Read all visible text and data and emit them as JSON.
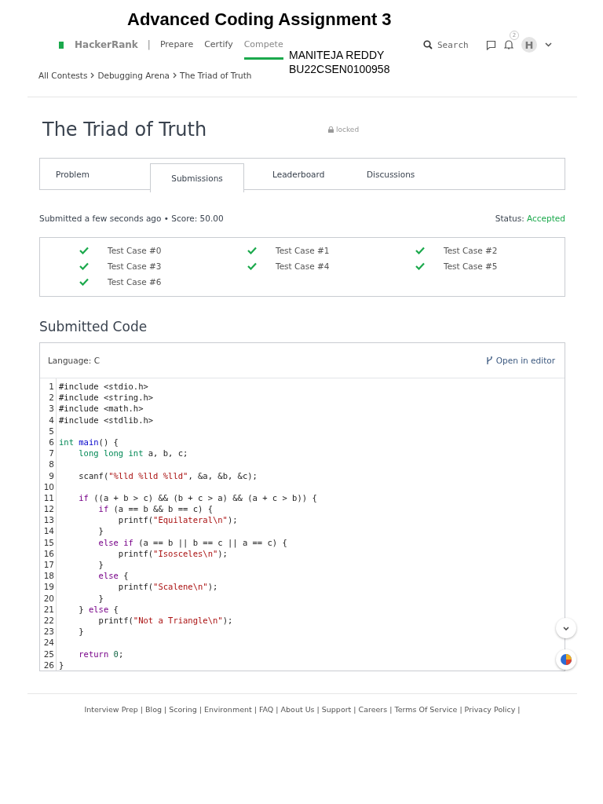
{
  "doc_title": "Advanced Coding Assignment 3",
  "nav": {
    "brand": "HackerRank",
    "divider": "|",
    "items": [
      {
        "label": "Prepare",
        "selected": false
      },
      {
        "label": "Certify",
        "selected": false
      },
      {
        "label": "Compete",
        "selected": true
      }
    ],
    "search_placeholder": "Search",
    "notifications": "2",
    "avatar": "H"
  },
  "student": [
    "MANITEJA REDDY",
    "BU22CSEN0100958"
  ],
  "breadcrumb": [
    "All Contests",
    "Debugging Arena",
    "The Triad of Truth"
  ],
  "challenge": {
    "title": "The Triad of Truth",
    "lock_label": "locked"
  },
  "tabs": [
    {
      "label": "Problem",
      "selected": false
    },
    {
      "label": "Submissions",
      "selected": true
    },
    {
      "label": "Leaderboard",
      "selected": false
    },
    {
      "label": "Discussions",
      "selected": false
    }
  ],
  "submission": {
    "summary": "Submitted a few seconds ago • Score: 50.00",
    "status_label": "Status:",
    "status": "Accepted"
  },
  "test_cases": [
    {
      "label": "Test Case #0",
      "passed": true
    },
    {
      "label": "Test Case #1",
      "passed": true
    },
    {
      "label": "Test Case #2",
      "passed": true
    },
    {
      "label": "Test Case #3",
      "passed": true
    },
    {
      "label": "Test Case #4",
      "passed": true
    },
    {
      "label": "Test Case #5",
      "passed": true
    },
    {
      "label": "Test Case #6",
      "passed": true
    }
  ],
  "code_section": {
    "heading": "Submitted Code",
    "language": "Language: C",
    "open_editor": "Open in editor",
    "lines": [
      {
        "number": "1",
        "tokens": [
          {
            "kind": "plain",
            "text": "#include <stdio.h>"
          }
        ]
      },
      {
        "number": "2",
        "tokens": [
          {
            "kind": "plain",
            "text": "#include <string.h>"
          }
        ]
      },
      {
        "number": "3",
        "tokens": [
          {
            "kind": "plain",
            "text": "#include <math.h>"
          }
        ]
      },
      {
        "number": "4",
        "tokens": [
          {
            "kind": "plain",
            "text": "#include <stdlib.h>"
          }
        ]
      },
      {
        "number": "5"
      },
      {
        "number": "6",
        "tokens": [
          {
            "kind": "type",
            "text": "int"
          },
          {
            "kind": "fn",
            "text": " main"
          },
          {
            "kind": "plain",
            "text": "() {"
          }
        ]
      },
      {
        "number": "7",
        "tokens": [
          {
            "kind": "type",
            "text": "    long long int"
          },
          {
            "kind": "plain",
            "text": " a, b, c;"
          }
        ]
      },
      {
        "number": "8"
      },
      {
        "number": "9",
        "tokens": [
          {
            "kind": "plain",
            "text": "    scanf("
          },
          {
            "kind": "str",
            "text": "\"%lld %lld %lld\""
          },
          {
            "kind": "plain",
            "text": ", &a, &b, &c);"
          }
        ]
      },
      {
        "number": "10"
      },
      {
        "number": "11",
        "tokens": [
          {
            "kind": "kw",
            "text": "    if"
          },
          {
            "kind": "plain",
            "text": " ((a + b > c) && (b + c > a) && (a + c > b)) {"
          }
        ]
      },
      {
        "number": "12",
        "tokens": [
          {
            "kind": "kw",
            "text": "        if"
          },
          {
            "kind": "plain",
            "text": " (a == b && b == c) {"
          }
        ]
      },
      {
        "number": "13",
        "tokens": [
          {
            "kind": "plain",
            "text": "            printf("
          },
          {
            "kind": "str",
            "text": "\"Equilateral\\n\""
          },
          {
            "kind": "plain",
            "text": ");"
          }
        ]
      },
      {
        "number": "14",
        "tokens": [
          {
            "kind": "plain",
            "text": "        }"
          }
        ]
      },
      {
        "number": "15",
        "tokens": [
          {
            "kind": "kw",
            "text": "        else if"
          },
          {
            "kind": "plain",
            "text": " (a == b || b == c || a == c) {"
          }
        ]
      },
      {
        "number": "16",
        "tokens": [
          {
            "kind": "plain",
            "text": "            printf("
          },
          {
            "kind": "str",
            "text": "\"Isosceles\\n\""
          },
          {
            "kind": "plain",
            "text": ");"
          }
        ]
      },
      {
        "number": "17",
        "tokens": [
          {
            "kind": "plain",
            "text": "        }"
          }
        ]
      },
      {
        "number": "18",
        "tokens": [
          {
            "kind": "kw",
            "text": "        else"
          },
          {
            "kind": "plain",
            "text": " {"
          }
        ]
      },
      {
        "number": "19",
        "tokens": [
          {
            "kind": "plain",
            "text": "            printf("
          },
          {
            "kind": "str",
            "text": "\"Scalene\\n\""
          },
          {
            "kind": "plain",
            "text": ");"
          }
        ]
      },
      {
        "number": "20",
        "tokens": [
          {
            "kind": "plain",
            "text": "        }"
          }
        ]
      },
      {
        "number": "21",
        "tokens": [
          {
            "kind": "plain",
            "text": "    } "
          },
          {
            "kind": "kw",
            "text": "else"
          },
          {
            "kind": "plain",
            "text": " {"
          }
        ]
      },
      {
        "number": "22",
        "tokens": [
          {
            "kind": "plain",
            "text": "        printf("
          },
          {
            "kind": "str",
            "text": "\"Not a Triangle\\n\""
          },
          {
            "kind": "plain",
            "text": ");"
          }
        ]
      },
      {
        "number": "23",
        "tokens": [
          {
            "kind": "plain",
            "text": "    }"
          }
        ]
      },
      {
        "number": "24"
      },
      {
        "number": "25",
        "tokens": [
          {
            "kind": "kw",
            "text": "    return"
          },
          {
            "kind": "num",
            "text": " 0"
          },
          {
            "kind": "plain",
            "text": ";"
          }
        ]
      },
      {
        "number": "26",
        "tokens": [
          {
            "kind": "plain",
            "text": "}"
          }
        ]
      }
    ]
  },
  "footer": {
    "separator": "|",
    "links": [
      "Interview Prep",
      "Blog",
      "Scoring",
      "Environment",
      "FAQ",
      "About Us",
      "Support",
      "Careers",
      "Terms Of Service",
      "Privacy Policy"
    ]
  }
}
